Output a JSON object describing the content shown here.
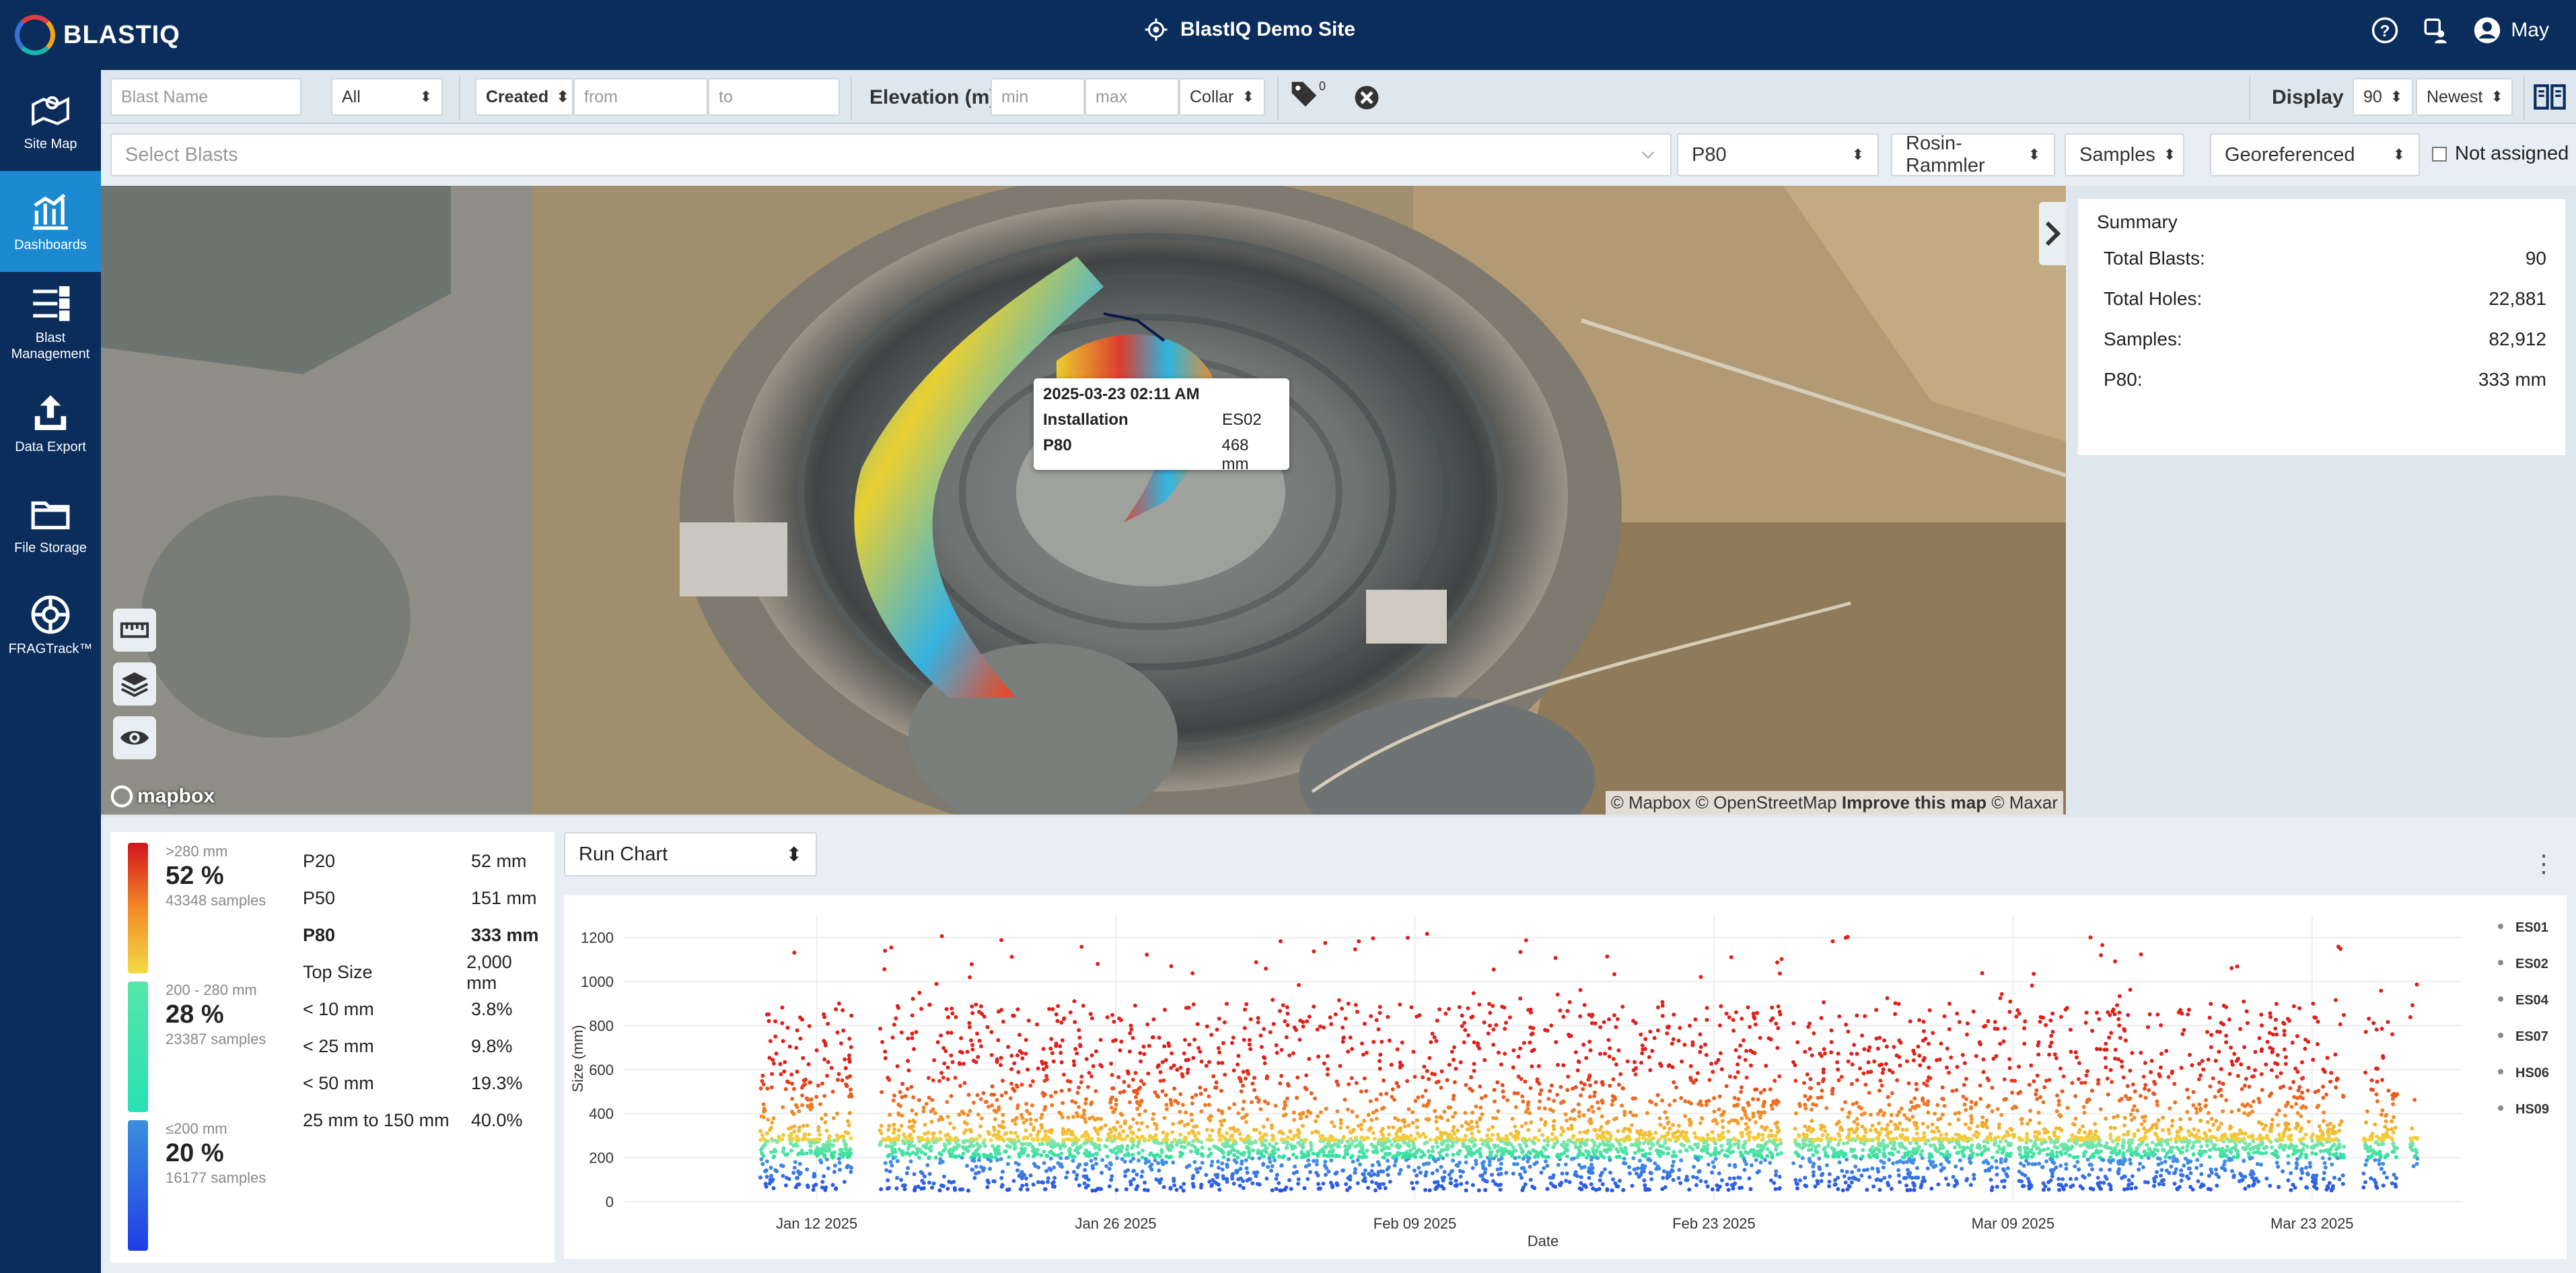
{
  "app": {
    "name": "BLASTIQ",
    "site": "BlastIQ Demo Site",
    "user": "May"
  },
  "icons": {
    "help": "help-circle-icon",
    "support": "support-icon",
    "user": "user-icon",
    "site": "location-target-icon",
    "docs": "book-icon"
  },
  "sidebar": {
    "items": [
      {
        "label": "Site Map",
        "icon": "map-icon"
      },
      {
        "label": "Dashboards",
        "icon": "dashboard-chart-icon",
        "active": true
      },
      {
        "label": "Blast Management",
        "icon": "list-icon"
      },
      {
        "label": "Data Export",
        "icon": "upload-icon"
      },
      {
        "label": "File Storage",
        "icon": "folder-icon"
      },
      {
        "label": "FRAGTrack™",
        "icon": "fragtrack-icon"
      }
    ]
  },
  "filters": {
    "blast_name_placeholder": "Blast Name",
    "type_value": "All",
    "date_type": "Created",
    "from_placeholder": "from",
    "to_placeholder": "to",
    "elevation_label": "Elevation (m)",
    "min_placeholder": "min",
    "max_placeholder": "max",
    "elevation_ref": "Collar",
    "tag_count": "0",
    "display_label": "Display",
    "display_count": "90",
    "sort_value": "Newest"
  },
  "selection": {
    "blasts_placeholder": "Select Blasts",
    "metric": "P80",
    "model": "Rosin-Rammler",
    "source": "Samples",
    "mode": "Georeferenced",
    "not_assigned": "Not assigned"
  },
  "map": {
    "tooltip": {
      "date": "2025-03-23 02:11 AM",
      "rows": [
        {
          "k": "Installation",
          "v": "ES02"
        },
        {
          "k": "P80",
          "v": "468 mm"
        }
      ]
    },
    "logo": "mapbox",
    "attribution": {
      "a": "© Mapbox",
      "b": "© OpenStreetMap",
      "c": "Improve this map",
      "d": "© Maxar"
    }
  },
  "summary": {
    "title": "Summary",
    "rows": [
      {
        "k": "Total Blasts:",
        "v": "90"
      },
      {
        "k": "Total Holes:",
        "v": "22,881"
      },
      {
        "k": "Samples:",
        "v": "82,912"
      },
      {
        "k": "P80:",
        "v": "333 mm"
      }
    ]
  },
  "legend": {
    "bands": [
      {
        "range": ">280 mm",
        "pct": "52 %",
        "samples": "43348 samples"
      },
      {
        "range": "200 - 280 mm",
        "pct": "28 %",
        "samples": "23387 samples"
      },
      {
        "range": "≤200 mm",
        "pct": "20 %",
        "samples": "16177 samples"
      }
    ],
    "stats": [
      {
        "k": "P20",
        "v": "52 mm"
      },
      {
        "k": "P50",
        "v": "151 mm"
      },
      {
        "k": "P80",
        "v": "333 mm",
        "bold": true
      },
      {
        "k": "Top Size",
        "v": "2,000 mm"
      },
      {
        "k": "< 10 mm",
        "v": "3.8%"
      },
      {
        "k": "< 25 mm",
        "v": "9.8%"
      },
      {
        "k": "< 50 mm",
        "v": "19.3%"
      },
      {
        "k": "25 mm to 150 mm",
        "v": "40.0%"
      }
    ]
  },
  "chart_selector": "Run Chart",
  "chart_data": {
    "type": "scatter",
    "title": "",
    "xlabel": "Date",
    "ylabel": "Size (mm)",
    "ylim": [
      0,
      1300
    ],
    "yticks": [
      0,
      200,
      400,
      600,
      800,
      1000,
      1200
    ],
    "xticks": [
      "Jan 12 2025",
      "Jan 26 2025",
      "Feb 09 2025",
      "Feb 23 2025",
      "Mar 09 2025",
      "Mar 23 2025"
    ],
    "xrange": [
      "2025-01-03",
      "2025-03-30"
    ],
    "grid": true,
    "legend_position": "right",
    "series": [
      {
        "name": "ES01"
      },
      {
        "name": "ES02"
      },
      {
        "name": "ES04"
      },
      {
        "name": "ES07"
      },
      {
        "name": "HS06"
      },
      {
        "name": "HS09"
      }
    ],
    "color_scale": {
      "low": "#1e3ee0",
      "mid": "#2ee0a0",
      "high": "#e0201a"
    }
  }
}
